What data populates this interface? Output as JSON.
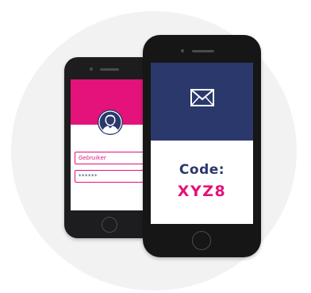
{
  "colors": {
    "background_circle": "#f1f2f1",
    "accent_pink": "#e4127b",
    "navy": "#2b386c",
    "phone_body": "#1a1a1b"
  },
  "login_phone": {
    "avatar_icon": "user-avatar-icon",
    "username_field": {
      "value": "Gebruiker"
    },
    "password_field": {
      "value": "******"
    }
  },
  "code_phone": {
    "mail_icon": "envelope-icon",
    "label": "Code:",
    "value": "XYZ8"
  }
}
